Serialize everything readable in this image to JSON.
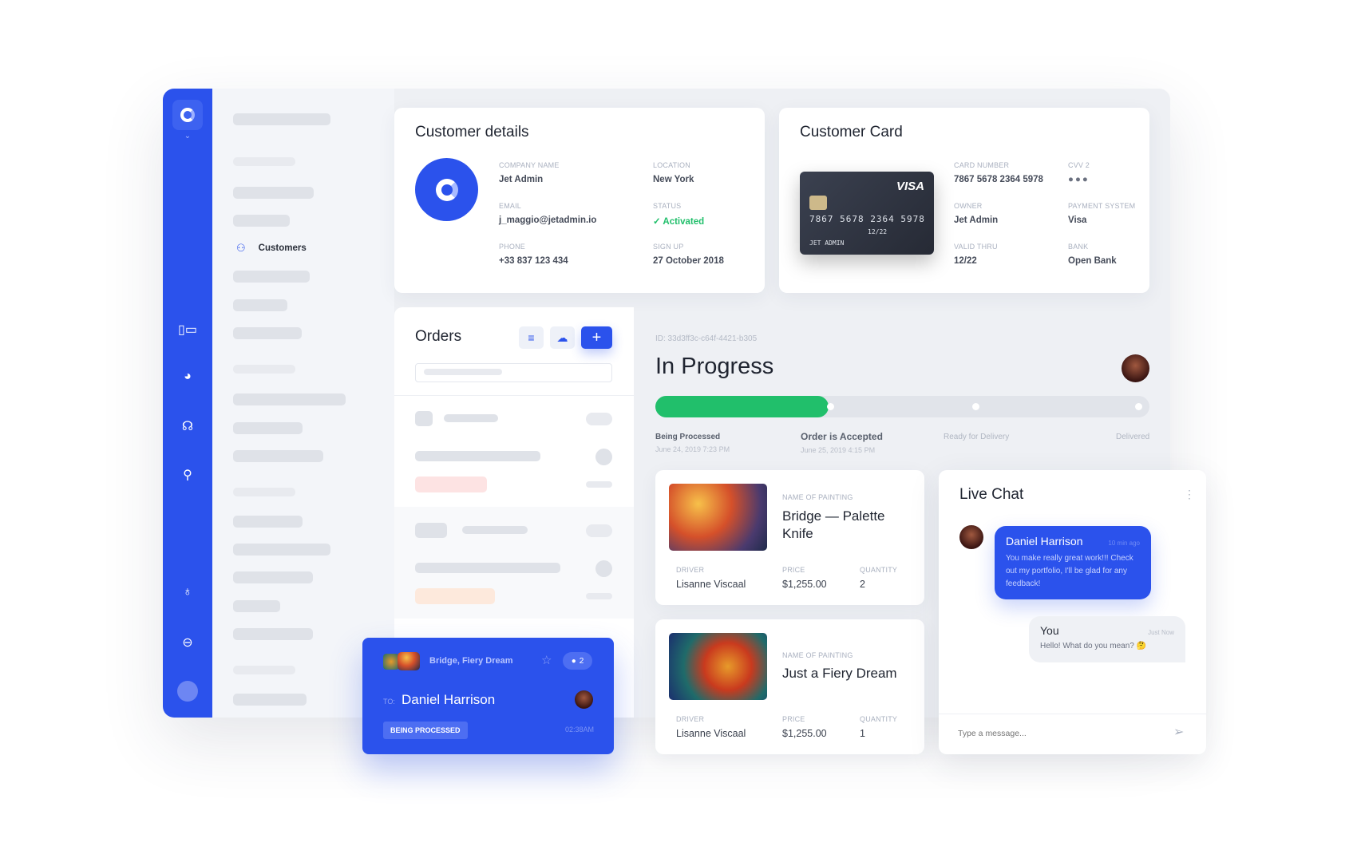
{
  "sidebar": {
    "icons": [
      "logo-icon",
      "chevron-down-icon",
      "dashboard-icon",
      "globe-icon",
      "headset-icon",
      "search-icon",
      "lightbulb-icon",
      "toggle-icon",
      "avatar"
    ]
  },
  "nav": {
    "active_item": "Customers"
  },
  "customer_details": {
    "title": "Customer details",
    "fields": [
      {
        "label": "Company Name",
        "value": "Jet Admin"
      },
      {
        "label": "Location",
        "value": "New York"
      },
      {
        "label": "Email",
        "value": "j_maggio@jetadmin.io"
      },
      {
        "label": "Status",
        "value": "Activated"
      },
      {
        "label": "Phone",
        "value": "+33 837 123 434"
      },
      {
        "label": "Sign Up",
        "value": "27 October 2018"
      }
    ]
  },
  "customer_card": {
    "title": "Customer Card",
    "card_brand": "VISA",
    "card_number_print": "7867 5678 2364 5978",
    "card_expiry": "12/22",
    "card_holder": "JET ADMIN",
    "fields": [
      {
        "label": "Card Number",
        "value": "7867 5678 2364 5978"
      },
      {
        "label": "CVV 2",
        "value": "●●●"
      },
      {
        "label": "Owner",
        "value": "Jet Admin"
      },
      {
        "label": "Payment System",
        "value": "Visa"
      },
      {
        "label": "Valid Thru",
        "value": "12/22"
      },
      {
        "label": "Bank",
        "value": "Open Bank"
      }
    ]
  },
  "orders": {
    "title": "Orders",
    "add_label": "+"
  },
  "progress": {
    "id": "ID: 33d3ff3c-c64f-4421-b305",
    "title": "In Progress",
    "percent": 35,
    "steps": [
      {
        "label": "Being Processed",
        "date": "June 24, 2019 7:23 PM"
      },
      {
        "label": "Order is Accepted",
        "date": "June 25, 2019 4:15 PM"
      },
      {
        "label": "Ready for Delivery",
        "date": ""
      },
      {
        "label": "Delivered",
        "date": ""
      }
    ]
  },
  "paintings": [
    {
      "name_label": "Name of painting",
      "name": "Bridge — Palette Knife",
      "driver_label": "Driver",
      "driver": "Lisanne Viscaal",
      "price_label": "Price",
      "price": "$1,255.00",
      "qty_label": "Quantity",
      "qty": "2"
    },
    {
      "name_label": "Name of painting",
      "name": "Just a Fiery Dream",
      "driver_label": "Driver",
      "driver": "Lisanne Viscaal",
      "price_label": "Price",
      "price": "$1,255.00",
      "qty_label": "Quantity",
      "qty": "1"
    }
  ],
  "chat": {
    "title": "Live Chat",
    "messages": [
      {
        "author": "Daniel Harrison",
        "time": "10 min ago",
        "text": "You make really great work!!! Check out my portfolio, I'll be glad for any feedback!"
      },
      {
        "author": "You",
        "time": "Just Now",
        "text": "Hello! What do you mean? 🤔"
      }
    ],
    "placeholder": "Type a message..."
  },
  "float_card": {
    "title": "Bridge, Fiery Dream",
    "comments": "2",
    "to_label": "TO:",
    "recipient": "Daniel Harrison",
    "status": "BEING PROCESSED",
    "time": "02:38AM"
  },
  "colors": {
    "accent": "#2b52ec",
    "success": "#21bf6b"
  }
}
